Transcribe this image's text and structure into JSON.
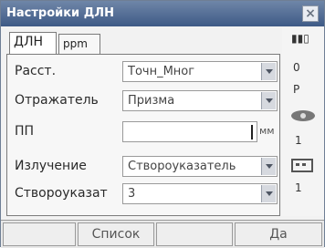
{
  "window": {
    "title": "Настройки ДЛН",
    "close_label": "×"
  },
  "tabs": [
    {
      "label": "ДЛН"
    },
    {
      "label": "ppm"
    }
  ],
  "rows": [
    {
      "label": "Расст.",
      "value": "Точн_Мног"
    },
    {
      "label": "Отражатель",
      "value": "Призма"
    },
    {
      "label": "ПП",
      "value": "",
      "unit": "мм"
    },
    {
      "label": "Излучение",
      "value": "Створоуказатель"
    },
    {
      "label": "Створоуказат",
      "value": "3"
    }
  ],
  "status": {
    "battery": "▮▮▯",
    "indicator_1": "0",
    "indicator_2": "P",
    "indicator_3": "1",
    "indicator_4": "1"
  },
  "softkeys": [
    {
      "label": ""
    },
    {
      "label": "Список"
    },
    {
      "label": ""
    },
    {
      "label": "Да"
    }
  ]
}
